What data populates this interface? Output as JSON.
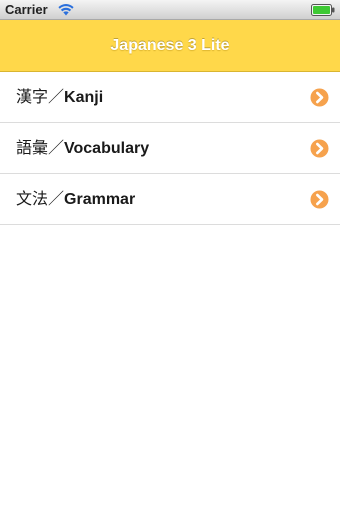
{
  "status_bar": {
    "carrier": "Carrier",
    "wifi_icon": "wifi-icon",
    "battery_icon": "battery-icon",
    "battery_color": "#3ec934"
  },
  "nav": {
    "title": "Japanese 3 Lite",
    "background": "#ffd84a"
  },
  "menu": {
    "items": [
      {
        "label_jp": "漢字／",
        "label_en": "Kanji",
        "icon": "chevron-right-icon"
      },
      {
        "label_jp": "語彙／",
        "label_en": "Vocabulary",
        "icon": "chevron-right-icon"
      },
      {
        "label_jp": "文法／",
        "label_en": "Grammar",
        "icon": "chevron-right-icon"
      }
    ],
    "accent_color": "#f6a24d"
  }
}
